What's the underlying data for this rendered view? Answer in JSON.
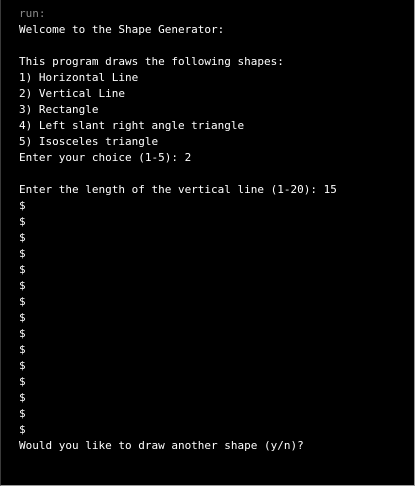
{
  "console": {
    "header_label": "run:",
    "welcome": "Welcome to the Shape Generator:",
    "blank": "",
    "intro": "This program draws the following shapes:",
    "menu": [
      "1) Horizontal Line",
      "2) Vertical Line",
      "3) Rectangle",
      "4) Left slant right angle triangle",
      "5) Isosceles triangle"
    ],
    "choice_prompt": "Enter your choice (1-5): 2",
    "length_prompt": "Enter the length of the vertical line (1-20): 15",
    "shape_char": "$",
    "shape_line_count": 15,
    "again_prompt": "Would you like to draw another shape (y/n)?"
  }
}
